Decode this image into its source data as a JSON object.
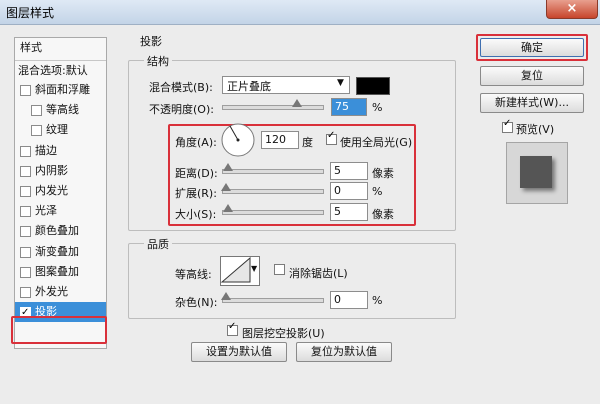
{
  "window": {
    "title": "图层样式",
    "close_label": "×"
  },
  "style_list": {
    "header": "样式",
    "blend_options": "混合选项:默认",
    "items": [
      {
        "label": "斜面和浮雕",
        "checked": false,
        "sub": false
      },
      {
        "label": "等高线",
        "checked": false,
        "sub": true
      },
      {
        "label": "纹理",
        "checked": false,
        "sub": true
      },
      {
        "label": "描边",
        "checked": false,
        "sub": false
      },
      {
        "label": "内阴影",
        "checked": false,
        "sub": false
      },
      {
        "label": "内发光",
        "checked": false,
        "sub": false
      },
      {
        "label": "光泽",
        "checked": false,
        "sub": false
      },
      {
        "label": "颜色叠加",
        "checked": false,
        "sub": false
      },
      {
        "label": "渐变叠加",
        "checked": false,
        "sub": false
      },
      {
        "label": "图案叠加",
        "checked": false,
        "sub": false
      },
      {
        "label": "外发光",
        "checked": false,
        "sub": false
      },
      {
        "label": "投影",
        "checked": true,
        "sub": false,
        "selected": true
      }
    ]
  },
  "drop_shadow": {
    "section_title": "投影",
    "structure": {
      "title": "结构",
      "blend_mode_label": "混合模式(B):",
      "blend_mode_value": "正片叠底",
      "shadow_color": "#000000",
      "opacity_label": "不透明度(O):",
      "opacity_value": "75",
      "opacity_unit": "%",
      "opacity_level": 0.75,
      "angle_label": "角度(A):",
      "angle_value": "120",
      "angle_unit": "度",
      "global_light_label": "使用全局光(G)",
      "global_light_checked": true,
      "distance_label": "距离(D):",
      "distance_value": "5",
      "distance_unit": "像素",
      "spread_label": "扩展(R):",
      "spread_value": "0",
      "spread_unit": "%",
      "size_label": "大小(S):",
      "size_value": "5",
      "size_unit": "像素"
    },
    "quality": {
      "title": "品质",
      "contour_label": "等高线:",
      "anti_alias_label": "消除锯齿(L)",
      "anti_alias_checked": false,
      "noise_label": "杂色(N):",
      "noise_value": "0",
      "noise_unit": "%"
    },
    "knockout_label": "图层挖空投影(U)",
    "knockout_checked": true,
    "make_default_label": "设置为默认值",
    "reset_default_label": "复位为默认值"
  },
  "buttons": {
    "ok": "确定",
    "reset": "复位",
    "new_style": "新建样式(W)...",
    "preview_label": "预览(V)",
    "preview_checked": true
  },
  "colors": {
    "highlight": "#3b8fd9",
    "annotation_red": "#d9303a"
  }
}
